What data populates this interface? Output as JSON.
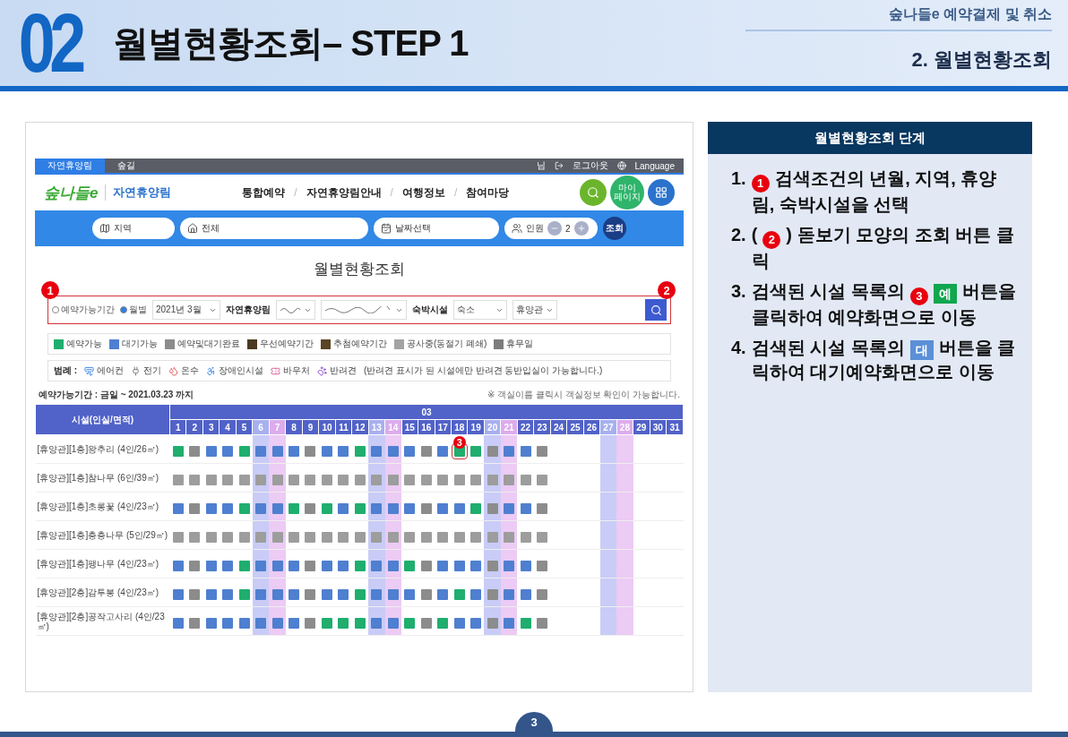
{
  "header": {
    "number": "02",
    "title": "월별현황조회– STEP 1",
    "section": "숲나들e 예약결제 및 취소",
    "subtitle": "2. 월별현황조회"
  },
  "screenshot": {
    "topbar": {
      "tabs": [
        {
          "label": "자연휴양림",
          "selected": true
        },
        {
          "label": "숲길",
          "selected": false
        }
      ],
      "user": "님",
      "logout": "로그아웃",
      "language": "Language"
    },
    "nav": {
      "logo": "숲나들e",
      "site": "자연휴양림",
      "menu": [
        "통합예약",
        "자연휴양림안내",
        "여행정보",
        "참여마당"
      ],
      "separator": "/",
      "mypage": "마이 페이지"
    },
    "search_bar": {
      "region": "지역",
      "area": "전체",
      "date": "날짜선택",
      "people_label": "인원",
      "people": "2",
      "submit": "조회"
    },
    "page_title": "월별현황조회",
    "filter": {
      "callouts": [
        "1",
        "2"
      ],
      "modes": [
        {
          "label": "예약가능기간",
          "selected": false
        },
        {
          "label": "월별",
          "selected": true
        }
      ],
      "month": "2021년 3월",
      "forest_label": "자연휴양림",
      "facility_label": "숙박시설",
      "facility_type": "숙소",
      "building": "휴양관"
    },
    "status_legend": [
      {
        "label": "예약가능",
        "color": "#1fae6e"
      },
      {
        "label": "대기가능",
        "color": "#4f7fd0"
      },
      {
        "label": "예약및대기완료",
        "color": "#8c8c8c"
      },
      {
        "label": "우선예약기간",
        "color": "#4a3b22"
      },
      {
        "label": "추첨예약기간",
        "color": "#5a4524"
      },
      {
        "label": "공사중(동절기 폐쇄)",
        "color": "#a3a3a3"
      },
      {
        "label": "휴무일",
        "color": "#7d7d7d"
      }
    ],
    "amenity_legend": {
      "label": "범례 :",
      "items": [
        {
          "kind": "aircon",
          "label": "에어컨"
        },
        {
          "kind": "power",
          "label": "전기"
        },
        {
          "kind": "hotwater",
          "label": "온수"
        },
        {
          "kind": "accessible",
          "label": "장애인시설"
        },
        {
          "kind": "voucher",
          "label": "바우처"
        },
        {
          "kind": "pet",
          "label": "반려견"
        }
      ],
      "note": "(반려견 표시가 된 시설에만 반려견 동반입실이 가능합니다.)"
    },
    "period": "예약가능기간 : 금일 ~ 2021.03.23 까지",
    "hint": "※ 객실이름 클릭시 객실정보 확인이 가능합니다.",
    "table": {
      "facility_header": "시설(인실/면적)",
      "month": "03",
      "days": [
        {
          "label": "1",
          "kind": "weekday"
        },
        {
          "label": "2",
          "kind": "weekday"
        },
        {
          "label": "3",
          "kind": "weekday"
        },
        {
          "label": "4",
          "kind": "weekday"
        },
        {
          "label": "5",
          "kind": "weekday"
        },
        {
          "label": "6",
          "kind": "saturday"
        },
        {
          "label": "7",
          "kind": "sunday"
        },
        {
          "label": "8",
          "kind": "weekday"
        },
        {
          "label": "9",
          "kind": "weekday"
        },
        {
          "label": "10",
          "kind": "weekday"
        },
        {
          "label": "11",
          "kind": "weekday"
        },
        {
          "label": "12",
          "kind": "weekday"
        },
        {
          "label": "13",
          "kind": "saturday"
        },
        {
          "label": "14",
          "kind": "sunday"
        },
        {
          "label": "15",
          "kind": "weekday"
        },
        {
          "label": "16",
          "kind": "weekday"
        },
        {
          "label": "17",
          "kind": "weekday"
        },
        {
          "label": "18",
          "kind": "weekday"
        },
        {
          "label": "19",
          "kind": "weekday"
        },
        {
          "label": "20",
          "kind": "saturday"
        },
        {
          "label": "21",
          "kind": "sunday"
        },
        {
          "label": "22",
          "kind": "weekday"
        },
        {
          "label": "23",
          "kind": "weekday"
        },
        {
          "label": "24",
          "kind": "weekday"
        },
        {
          "label": "25",
          "kind": "weekday"
        },
        {
          "label": "26",
          "kind": "weekday"
        },
        {
          "label": "27",
          "kind": "saturday"
        },
        {
          "label": "28",
          "kind": "sunday"
        },
        {
          "label": "29",
          "kind": "weekday"
        },
        {
          "label": "30",
          "kind": "weekday"
        },
        {
          "label": "31",
          "kind": "weekday"
        }
      ],
      "rows": [
        {
          "name": "[휴양관][1층]왕추리 (4인/26㎡)",
          "cells": [
            {
              "kind": "avail"
            },
            {
              "kind": "done"
            },
            {
              "kind": "wait"
            },
            {
              "kind": "wait"
            },
            {
              "kind": "avail"
            },
            {
              "kind": "wait"
            },
            {
              "kind": "wait"
            },
            {
              "kind": "wait"
            },
            {
              "kind": "done"
            },
            {
              "kind": "wait"
            },
            {
              "kind": "wait"
            },
            {
              "kind": "avail"
            },
            {
              "kind": "wait"
            },
            {
              "kind": "wait"
            },
            {
              "kind": "wait"
            },
            {
              "kind": "done"
            },
            {
              "kind": "wait"
            },
            {
              "kind": "avail",
              "highlighted": true,
              "callout": "3"
            },
            {
              "kind": "avail"
            },
            {
              "kind": "done"
            },
            {
              "kind": "wait"
            },
            {
              "kind": "wait"
            },
            {
              "kind": "done"
            }
          ]
        },
        {
          "name": "[휴양관][1층]참나무 (6인/39㎡)",
          "cells": [
            {
              "kind": "closed"
            },
            {
              "kind": "closed"
            },
            {
              "kind": "closed"
            },
            {
              "kind": "closed"
            },
            {
              "kind": "closed"
            },
            {
              "kind": "closed"
            },
            {
              "kind": "closed"
            },
            {
              "kind": "closed"
            },
            {
              "kind": "closed"
            },
            {
              "kind": "closed"
            },
            {
              "kind": "closed"
            },
            {
              "kind": "closed"
            },
            {
              "kind": "closed"
            },
            {
              "kind": "closed"
            },
            {
              "kind": "closed"
            },
            {
              "kind": "closed"
            },
            {
              "kind": "closed"
            },
            {
              "kind": "closed"
            },
            {
              "kind": "closed"
            },
            {
              "kind": "closed"
            },
            {
              "kind": "closed"
            },
            {
              "kind": "closed"
            },
            {
              "kind": "closed"
            }
          ]
        },
        {
          "name": "[휴양관][1층]초롱꽃 (4인/23㎡)",
          "cells": [
            {
              "kind": "wait"
            },
            {
              "kind": "done"
            },
            {
              "kind": "wait"
            },
            {
              "kind": "wait"
            },
            {
              "kind": "avail"
            },
            {
              "kind": "wait"
            },
            {
              "kind": "wait"
            },
            {
              "kind": "avail"
            },
            {
              "kind": "done"
            },
            {
              "kind": "avail"
            },
            {
              "kind": "wait"
            },
            {
              "kind": "avail"
            },
            {
              "kind": "wait"
            },
            {
              "kind": "wait"
            },
            {
              "kind": "wait"
            },
            {
              "kind": "done"
            },
            {
              "kind": "wait"
            },
            {
              "kind": "wait"
            },
            {
              "kind": "avail"
            },
            {
              "kind": "done"
            },
            {
              "kind": "wait"
            },
            {
              "kind": "wait"
            },
            {
              "kind": "done"
            }
          ]
        },
        {
          "name": "[휴양관][1층]층층나무 (5인/29㎡)",
          "cells": [
            {
              "kind": "closed"
            },
            {
              "kind": "closed"
            },
            {
              "kind": "closed"
            },
            {
              "kind": "closed"
            },
            {
              "kind": "closed"
            },
            {
              "kind": "closed"
            },
            {
              "kind": "closed"
            },
            {
              "kind": "closed"
            },
            {
              "kind": "closed"
            },
            {
              "kind": "closed"
            },
            {
              "kind": "closed"
            },
            {
              "kind": "closed"
            },
            {
              "kind": "closed"
            },
            {
              "kind": "closed"
            },
            {
              "kind": "closed"
            },
            {
              "kind": "closed"
            },
            {
              "kind": "closed"
            },
            {
              "kind": "closed"
            },
            {
              "kind": "closed"
            },
            {
              "kind": "closed"
            },
            {
              "kind": "closed"
            },
            {
              "kind": "closed"
            },
            {
              "kind": "closed"
            }
          ]
        },
        {
          "name": "[휴양관][1층]팽나무 (4인/23㎡)",
          "cells": [
            {
              "kind": "wait"
            },
            {
              "kind": "done"
            },
            {
              "kind": "wait"
            },
            {
              "kind": "wait"
            },
            {
              "kind": "avail"
            },
            {
              "kind": "wait"
            },
            {
              "kind": "wait"
            },
            {
              "kind": "wait"
            },
            {
              "kind": "done"
            },
            {
              "kind": "wait"
            },
            {
              "kind": "wait"
            },
            {
              "kind": "avail"
            },
            {
              "kind": "wait"
            },
            {
              "kind": "wait"
            },
            {
              "kind": "avail"
            },
            {
              "kind": "done"
            },
            {
              "kind": "wait"
            },
            {
              "kind": "wait"
            },
            {
              "kind": "wait"
            },
            {
              "kind": "done"
            },
            {
              "kind": "wait"
            },
            {
              "kind": "wait"
            },
            {
              "kind": "done"
            }
          ]
        },
        {
          "name": "[휴양관][2층]감투봉 (4인/23㎡)",
          "cells": [
            {
              "kind": "wait"
            },
            {
              "kind": "done"
            },
            {
              "kind": "wait"
            },
            {
              "kind": "wait"
            },
            {
              "kind": "avail"
            },
            {
              "kind": "wait"
            },
            {
              "kind": "wait"
            },
            {
              "kind": "wait"
            },
            {
              "kind": "done"
            },
            {
              "kind": "wait"
            },
            {
              "kind": "wait"
            },
            {
              "kind": "avail"
            },
            {
              "kind": "wait"
            },
            {
              "kind": "wait"
            },
            {
              "kind": "wait"
            },
            {
              "kind": "done"
            },
            {
              "kind": "wait"
            },
            {
              "kind": "avail"
            },
            {
              "kind": "wait"
            },
            {
              "kind": "done"
            },
            {
              "kind": "wait"
            },
            {
              "kind": "wait"
            },
            {
              "kind": "done"
            }
          ]
        },
        {
          "name": "[휴양관][2층]공작고사리 (4인/23㎡)",
          "cells": [
            {
              "kind": "wait"
            },
            {
              "kind": "done"
            },
            {
              "kind": "wait"
            },
            {
              "kind": "wait"
            },
            {
              "kind": "wait"
            },
            {
              "kind": "wait"
            },
            {
              "kind": "wait"
            },
            {
              "kind": "wait"
            },
            {
              "kind": "done"
            },
            {
              "kind": "avail"
            },
            {
              "kind": "avail"
            },
            {
              "kind": "avail"
            },
            {
              "kind": "wait"
            },
            {
              "kind": "wait"
            },
            {
              "kind": "avail"
            },
            {
              "kind": "done"
            },
            {
              "kind": "avail"
            },
            {
              "kind": "wait"
            },
            {
              "kind": "wait"
            },
            {
              "kind": "done"
            },
            {
              "kind": "wait"
            },
            {
              "kind": "avail"
            },
            {
              "kind": "done"
            }
          ]
        }
      ]
    }
  },
  "steps_panel": {
    "title": "월별현황조회 단계",
    "steps": [
      {
        "number": "1.",
        "segments": [
          {
            "kind": "marker",
            "text": "1"
          },
          {
            "kind": "text",
            "text": "검색조건의 년월, 지역, 휴양림, 숙박시설을 선택"
          }
        ]
      },
      {
        "number": "2.",
        "segments": [
          {
            "kind": "text",
            "text": "("
          },
          {
            "kind": "marker",
            "text": "2"
          },
          {
            "kind": "text",
            "text": ") 돋보기 모양의 조회 버튼 클릭"
          }
        ]
      },
      {
        "number": "3.",
        "segments": [
          {
            "kind": "text",
            "text": "검색된 시설 목록의"
          },
          {
            "kind": "marker",
            "text": "3"
          },
          {
            "kind": "badge",
            "text": "예",
            "color": "#12a64f"
          },
          {
            "kind": "text",
            "text": "버튼을 클릭하여 예약화면으로 이동"
          }
        ]
      },
      {
        "number": "4.",
        "segments": [
          {
            "kind": "text",
            "text": "검색된 시설 목록의"
          },
          {
            "kind": "badge",
            "text": "대",
            "color": "#5b8fd6"
          },
          {
            "kind": "text",
            "text": "버튼을 클릭하여 대기예약화면으로 이동"
          }
        ]
      }
    ]
  },
  "page_number": "3"
}
